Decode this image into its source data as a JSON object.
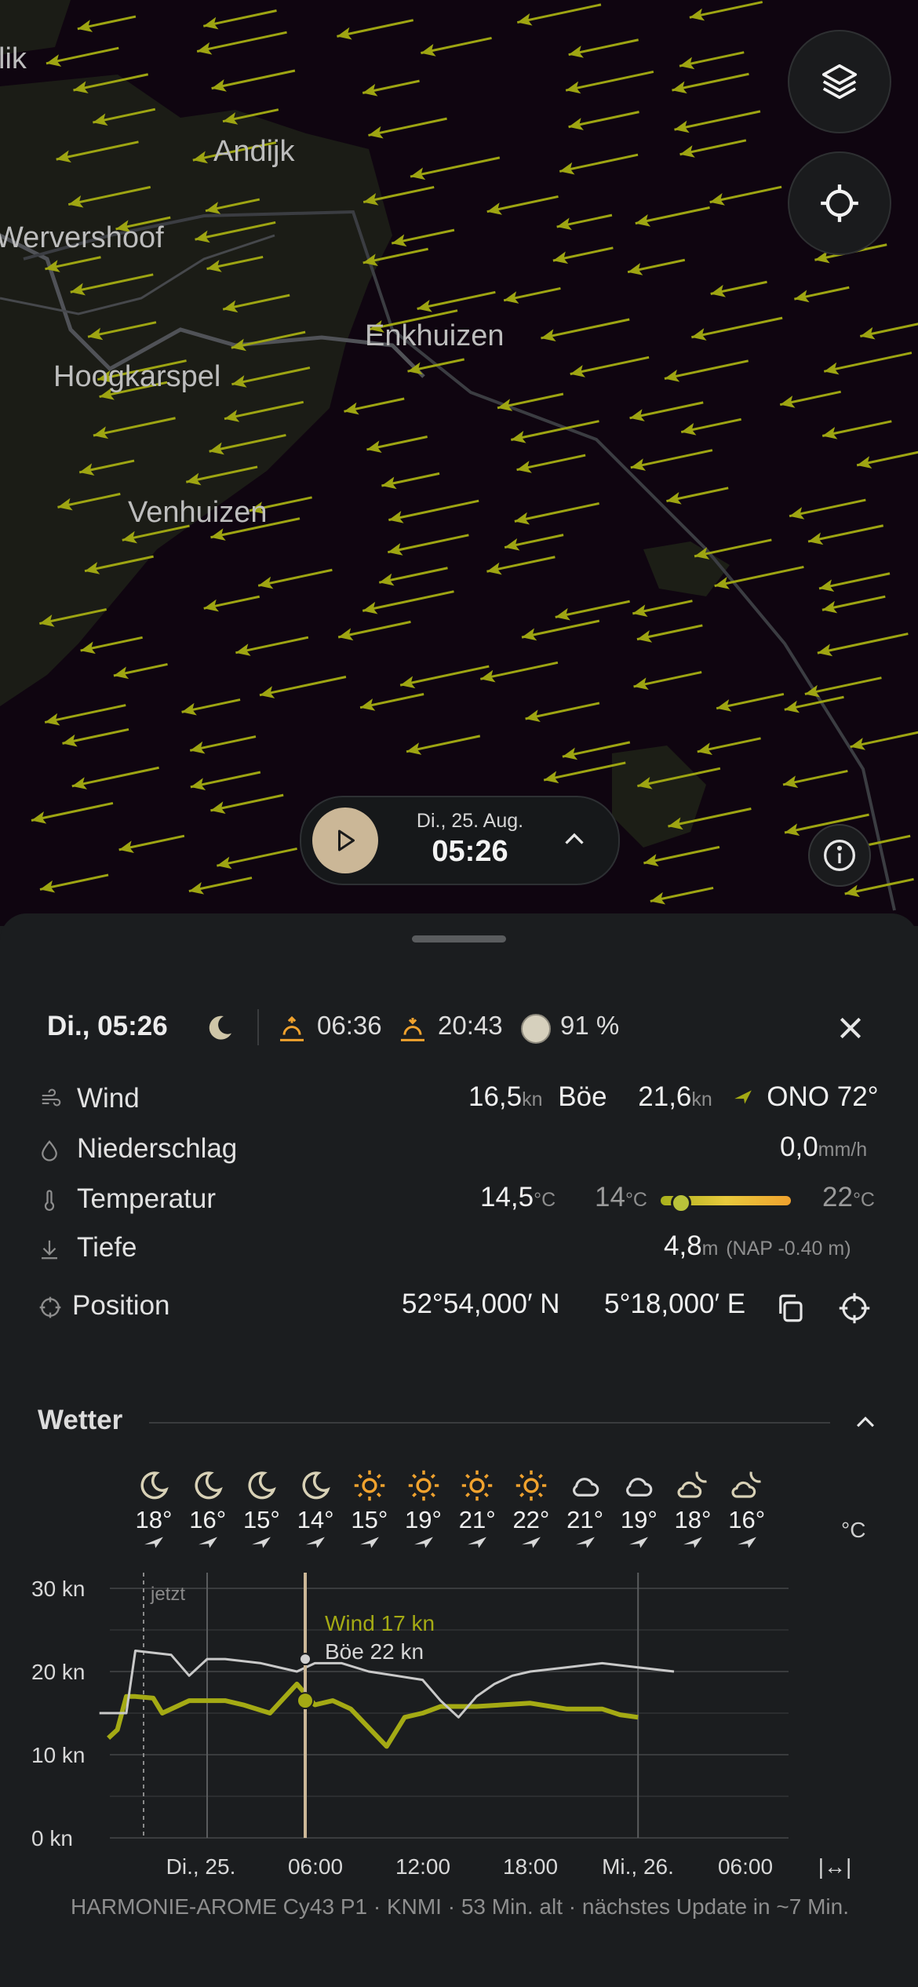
{
  "map": {
    "towns": [
      {
        "name": "Andijk"
      },
      {
        "name": "Wervershoof"
      },
      {
        "name": "Enkhuizen"
      },
      {
        "name": "Hoogkarspel"
      },
      {
        "name": "Venhuizen"
      },
      {
        "name": "lik"
      }
    ],
    "layers_icon": "layers-icon",
    "locate_icon": "crosshair-icon",
    "info_icon": "info-icon",
    "timeline": {
      "date": "Di., 25. Aug.",
      "time": "05:26"
    },
    "arrow_color": "#9ea512"
  },
  "header": {
    "datetime": "Di., 05:26",
    "sunrise": "06:36",
    "sunset": "20:43",
    "moon": "91 %"
  },
  "details": {
    "wind": {
      "label": "Wind",
      "speed": "16,5",
      "speed_unit": "kn",
      "gust_label": "Böe",
      "gust": "21,6",
      "gust_unit": "kn",
      "direction": "ONO 72°"
    },
    "precip": {
      "label": "Niederschlag",
      "value": "0,0",
      "unit": "mm/h"
    },
    "temp": {
      "label": "Temperatur",
      "value": "14,5",
      "unit": "°C",
      "min": "14",
      "min_unit": "°C",
      "max": "22",
      "max_unit": "°C"
    },
    "depth": {
      "label": "Tiefe",
      "value": "4,8",
      "unit": "m",
      "note": "(NAP -0.40 m)"
    },
    "position": {
      "label": "Position",
      "lat": "52°54,000′ N",
      "lon": "5°18,000′ E"
    }
  },
  "weather": {
    "title": "Wetter",
    "unit": "°C",
    "hours": [
      {
        "icon": "moon",
        "temp": "18°"
      },
      {
        "icon": "moon",
        "temp": "16°"
      },
      {
        "icon": "moon",
        "temp": "15°"
      },
      {
        "icon": "moon",
        "temp": "14°"
      },
      {
        "icon": "sun",
        "temp": "15°"
      },
      {
        "icon": "sun",
        "temp": "19°"
      },
      {
        "icon": "sun",
        "temp": "21°"
      },
      {
        "icon": "sun",
        "temp": "22°"
      },
      {
        "icon": "cloud",
        "temp": "21°"
      },
      {
        "icon": "cloud",
        "temp": "19°"
      },
      {
        "icon": "cloud-moon",
        "temp": "18°"
      },
      {
        "icon": "cloud-moon",
        "temp": "16°"
      }
    ],
    "now_label": "jetzt",
    "cursor_wind": "Wind 17 kn",
    "cursor_gust": "Böe 22 kn",
    "x_labels": [
      "Di., 25.",
      "06:00",
      "12:00",
      "18:00",
      "Mi., 26.",
      "06:00"
    ],
    "expand_label": "|↔|",
    "footer": "HARMONIE-AROME Cy43 P1 · KNMI · 53 Min. alt · nächstes Update in ~7 Min."
  },
  "chart_data": {
    "type": "line",
    "title": "",
    "xlabel": "",
    "ylabel": "",
    "y_ticks": [
      "30 kn",
      "20 kn",
      "10 kn",
      "0 kn"
    ],
    "ylim": [
      0,
      30
    ],
    "x": [
      "Di. 00:00",
      "Di. 06:00",
      "Di. 12:00",
      "Di. 18:00",
      "Mi. 00:00",
      "Mi. 06:00"
    ],
    "series": [
      {
        "name": "Wind",
        "color": "#a4aa14",
        "points": [
          [
            -5.5,
            12
          ],
          [
            -5,
            13
          ],
          [
            -4.5,
            17
          ],
          [
            -4,
            17
          ],
          [
            -3,
            16.8
          ],
          [
            -2.5,
            15
          ],
          [
            -1,
            16.5
          ],
          [
            1,
            16.5
          ],
          [
            2,
            16
          ],
          [
            3.5,
            15
          ],
          [
            5,
            18.5
          ],
          [
            6,
            16
          ],
          [
            7,
            16.5
          ],
          [
            8,
            15.5
          ],
          [
            10,
            11
          ],
          [
            11,
            14.5
          ],
          [
            12,
            15
          ],
          [
            13,
            15.8
          ],
          [
            15,
            15.8
          ],
          [
            18,
            16.2
          ],
          [
            20,
            15.5
          ],
          [
            22,
            15.5
          ],
          [
            23,
            14.8
          ],
          [
            24,
            14.5
          ]
        ]
      },
      {
        "name": "Böe",
        "color": "#c9c9c9",
        "points": [
          [
            -6,
            15
          ],
          [
            -4.5,
            15
          ],
          [
            -4,
            22.5
          ],
          [
            -2,
            22
          ],
          [
            -1,
            19.5
          ],
          [
            0,
            21.5
          ],
          [
            1,
            21.5
          ],
          [
            3,
            21
          ],
          [
            5,
            20
          ],
          [
            6,
            21
          ],
          [
            7.5,
            21
          ],
          [
            9,
            20
          ],
          [
            12,
            19
          ],
          [
            13,
            16.5
          ],
          [
            14,
            14.5
          ],
          [
            15,
            17
          ],
          [
            16,
            18.5
          ],
          [
            17,
            19.5
          ],
          [
            18,
            20
          ],
          [
            20,
            20.5
          ],
          [
            22,
            21
          ],
          [
            24,
            20.5
          ],
          [
            26,
            20
          ]
        ]
      }
    ]
  }
}
